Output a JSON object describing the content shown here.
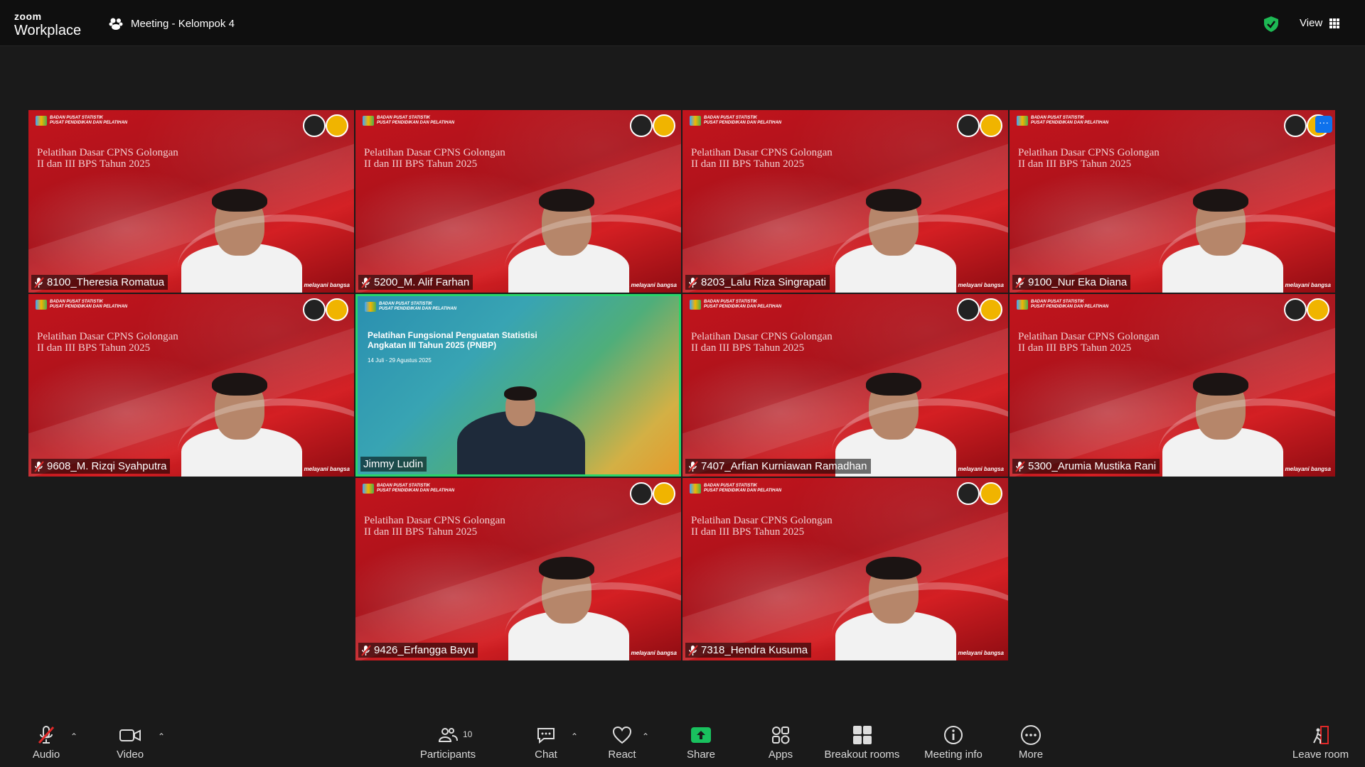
{
  "app": {
    "brand_small": "zoom",
    "brand_large": "Workplace"
  },
  "meeting": {
    "title": "Meeting - Kelompok 4"
  },
  "topbar": {
    "view_label": "View"
  },
  "background": {
    "org_line1": "BADAN PUSAT STATISTIK",
    "org_line2": "PUSAT PENDIDIKAN DAN PELATIHAN",
    "training_title": "Pelatihan Dasar CPNS Golongan II dan III BPS Tahun 2025",
    "slogan": "bangga melayani bangsa"
  },
  "active_background": {
    "title": "Pelatihan Fungsional Penguatan Statistisi Angkatan III Tahun 2025 (PNBP)",
    "dates": "14 Juli - 29 Agustus 2025"
  },
  "participants": [
    {
      "name": "8100_Theresia Romatua"
    },
    {
      "name": "5200_M. Alif Farhan"
    },
    {
      "name": "8203_Lalu Riza Singrapati"
    },
    {
      "name": "9100_Nur Eka Diana"
    },
    {
      "name": "9608_M. Rizqi Syahputra"
    },
    {
      "name": "Jimmy Ludin"
    },
    {
      "name": "7407_Arfian Kurniawan Ramadhan"
    },
    {
      "name": "5300_Arumia Mustika Rani"
    },
    {
      "name": "9426_Erfangga Bayu"
    },
    {
      "name": "7318_Hendra Kusuma"
    }
  ],
  "toolbar": {
    "audio": "Audio",
    "video": "Video",
    "participants": "Participants",
    "participants_count": "10",
    "chat": "Chat",
    "react": "React",
    "share": "Share",
    "apps": "Apps",
    "breakout": "Breakout rooms",
    "info": "Meeting info",
    "more": "More",
    "leave": "Leave room"
  },
  "colors": {
    "accent": "#0e72ed",
    "share_green": "#19c15e",
    "active_speaker": "#29d46a",
    "secure_green": "#1db954",
    "tile_red": "#c3141d"
  }
}
